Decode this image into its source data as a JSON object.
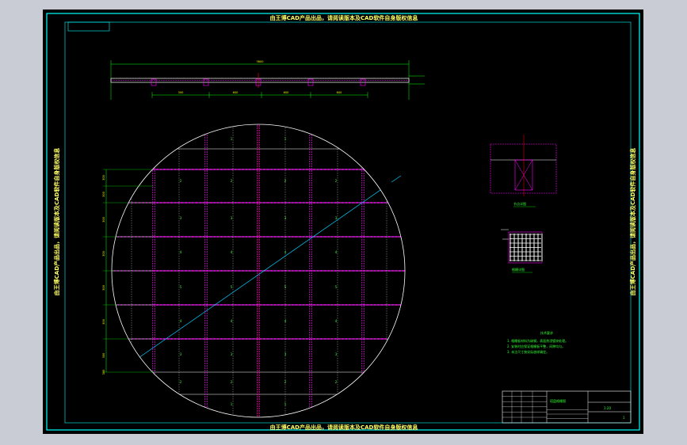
{
  "colors": {
    "background": "#000000",
    "frame": "#00ffff",
    "outline": "#ffffff",
    "beam": "#ff00ff",
    "dimension": "#00ff00",
    "text": "#ffff00"
  },
  "watermarks": {
    "top": "由王博CAD产品出品，请阅读版本及CAD软件自身版权信息",
    "bottom": "由王博CAD产品出品，请阅读版本及CAD软件自身版权信息",
    "left": "由王博CAD产品出品，请阅读版本及CAD软件自身版权信息",
    "right": "由王博CAD产品出品，请阅读版本及CAD软件自身版权信息"
  },
  "drawing": {
    "overall_dim": "3600",
    "segment_dims": [
      "300",
      "600",
      "600",
      "600",
      "600"
    ],
    "side_dims": [
      "300",
      "300",
      "300",
      "300",
      "300",
      "300",
      "300",
      "300"
    ],
    "cell_numbers": [
      "1",
      "2",
      "3",
      "4",
      "5",
      "4",
      "3",
      "2",
      "1"
    ],
    "detail_a_label": "节点详图",
    "detail_b_label": "格栅详图",
    "notes_title": "技术要求",
    "notes": [
      "1. 格栅板材料为碳钢，表面热浸镀锌处理。",
      "2. 安装时应保证格栅板平整，间隙均匀。",
      "3. 未注尺寸按实际放样确定。"
    ],
    "title_block": {
      "drawing_name": "塔盘格栅图",
      "scale": "1:20",
      "sheet": "1"
    }
  }
}
